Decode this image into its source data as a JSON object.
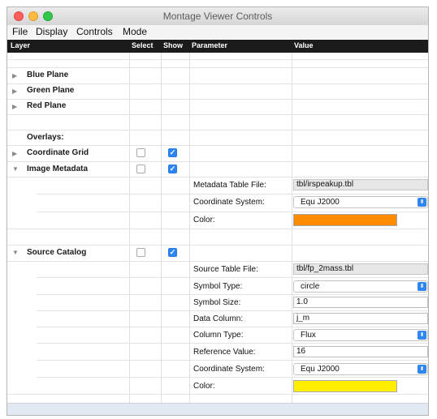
{
  "window": {
    "title": "Montage Viewer Controls"
  },
  "menu": [
    "File",
    "Display",
    "Controls",
    "Mode"
  ],
  "columns": {
    "layer": "Layer",
    "select": "Select",
    "show": "Show",
    "parameter": "Parameter",
    "value": "Value"
  },
  "layers": {
    "blue": "Blue Plane",
    "green": "Green Plane",
    "red": "Red Plane",
    "overlays": "Overlays:",
    "grid": "Coordinate Grid",
    "metadata": "Image Metadata",
    "catalog": "Source Catalog"
  },
  "metadata": {
    "table_file_label": "Metadata Table File:",
    "table_file": "tbl/irspeakup.tbl",
    "coord_label": "Coordinate System:",
    "coord": "Equ J2000",
    "color_label": "Color:",
    "color": "#ff8c00"
  },
  "catalog": {
    "table_file_label": "Source Table File:",
    "table_file": "tbl/fp_2mass.tbl",
    "symbol_type_label": "Symbol Type:",
    "symbol_type": "circle",
    "symbol_size_label": "Symbol Size:",
    "symbol_size": "1.0",
    "data_column_label": "Data Column:",
    "data_column": "j_m",
    "column_type_label": "Column Type:",
    "column_type": "Flux",
    "ref_value_label": "Reference Value:",
    "ref_value": "16",
    "coord_label": "Coordinate System:",
    "coord": "Equ J2000",
    "color_label": "Color:",
    "color": "#ffee00"
  },
  "accent": "#2d86f5"
}
